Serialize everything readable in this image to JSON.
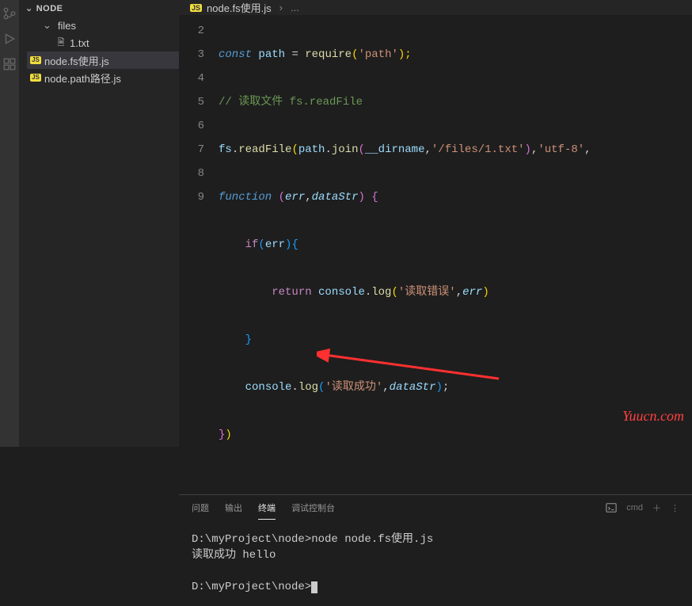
{
  "sidebar": {
    "title": "NODE",
    "folder": "files",
    "files": [
      "1.txt",
      "node.fs使用.js",
      "node.path路径.js"
    ]
  },
  "tab": {
    "filename": "node.fs使用.js",
    "crumb_sep": "›",
    "crumb_tail": "..."
  },
  "editor": {
    "lines": [
      "2",
      "3",
      "4",
      "",
      "5",
      "6",
      "7",
      "8",
      "9"
    ],
    "c2a": "const",
    "c2b": " path ",
    "c2c": "=",
    "c2d": " require",
    "c2e": "(",
    "c2f": "'path'",
    "c2g": ");",
    "c3": "// 读取文件 fs.readFile",
    "c4a": "fs",
    "c4b": ".",
    "c4c": "readFile",
    "c4d": "(",
    "c4e": "path",
    "c4f": ".",
    "c4g": "join",
    "c4h": "(",
    "c4i": "__dirname",
    "c4j": ",",
    "c4k": "'/files/1.txt'",
    "c4l": ")",
    "c4m": ",",
    "c4n": "'utf-8'",
    "c4o": ",",
    "c4p": "function ",
    "c4q": "(",
    "c4r": "err",
    "c4s": ",",
    "c4t": "dataStr",
    "c4u": ")",
    "c4v": " {",
    "c5a": "if",
    "c5b": "(",
    "c5c": "err",
    "c5d": ")",
    "c5e": "{",
    "c6a": "return ",
    "c6b": "console",
    "c6c": ".",
    "c6d": "log",
    "c6e": "(",
    "c6f": "'读取错误'",
    "c6g": ",",
    "c6h": "err",
    "c6i": ")",
    "c7": "}",
    "c8a": "console",
    "c8b": ".",
    "c8c": "log",
    "c8d": "(",
    "c8e": "'读取成功'",
    "c8f": ",",
    "c8g": "dataStr",
    "c8h": ")",
    "c8i": ";",
    "c9a": "}",
    "c9b": ")"
  },
  "panel": {
    "tabs": [
      "问题",
      "输出",
      "终端",
      "调试控制台"
    ],
    "shell": "cmd"
  },
  "terminal": {
    "line1": "D:\\myProject\\node>node node.fs使用.js",
    "line2": "读取成功 hello",
    "line3": "D:\\myProject\\node>"
  },
  "watermark": "Yuucn.com"
}
